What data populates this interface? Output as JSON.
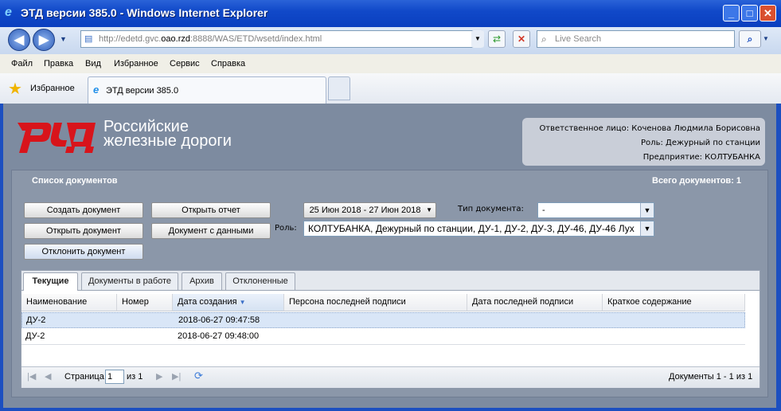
{
  "window": {
    "title": "ЭТД версии 385.0 - Windows Internet Explorer",
    "minimize": "_",
    "maximize": "□",
    "close": "✕"
  },
  "address_bar": {
    "url_prefix": "http://edetd.gvc.",
    "url_host": "oao.rzd",
    "url_rest": ":8888/WAS/ETD/wsetd/index.html",
    "search_placeholder": "Live Search"
  },
  "menu": [
    "Файл",
    "Правка",
    "Вид",
    "Избранное",
    "Сервис",
    "Справка"
  ],
  "favorites": {
    "label": "Избранное",
    "tab_title": "ЭТД версии 385.0"
  },
  "logo": {
    "line1": "Российские",
    "line2": "железные дороги",
    "mark_color": "#d8141b"
  },
  "user_info": {
    "responsible": "Ответственное лицо: Коченова Людмила Борисовна",
    "role": "Роль: Дежурный по станции",
    "enterprise": "Предприятие: КОЛТУБАНКА"
  },
  "panel": {
    "title": "Список документов",
    "total": "Всего документов: 1"
  },
  "buttons": {
    "create": "Создать документ",
    "open": "Открыть документ",
    "reject": "Отклонить документ",
    "open_report": "Открыть отчет",
    "doc_with_data": "Документ с данными"
  },
  "filters": {
    "date_range": "25 Июн 2018 - 27 Июн 2018",
    "doc_type_label": "Тип документа:",
    "doc_type_value": "-",
    "role_label": "Роль:",
    "role_value": "КОЛТУБАНКА, Дежурный по станции, ДУ-1, ДУ-2, ДУ-3, ДУ-46, ДУ-46 Лух"
  },
  "tabs": [
    "Текущие",
    "Документы в работе",
    "Архив",
    "Отклоненные"
  ],
  "columns": [
    "Наименование",
    "Номер",
    "Дата создания",
    "Персона последней подписи",
    "Дата последней подписи",
    "Краткое содержание"
  ],
  "rows": [
    {
      "name": "ДУ-2",
      "number": "",
      "created": "2018-06-27 09:47:58",
      "signer": "",
      "signed": "",
      "summary": ""
    },
    {
      "name": "ДУ-2",
      "number": "",
      "created": "2018-06-27 09:48:00",
      "signer": "",
      "signed": "",
      "summary": ""
    }
  ],
  "pager": {
    "page_label": "Страница",
    "page_value": "1",
    "of_label": "из 1",
    "status": "Документы 1 - 1 из 1"
  }
}
